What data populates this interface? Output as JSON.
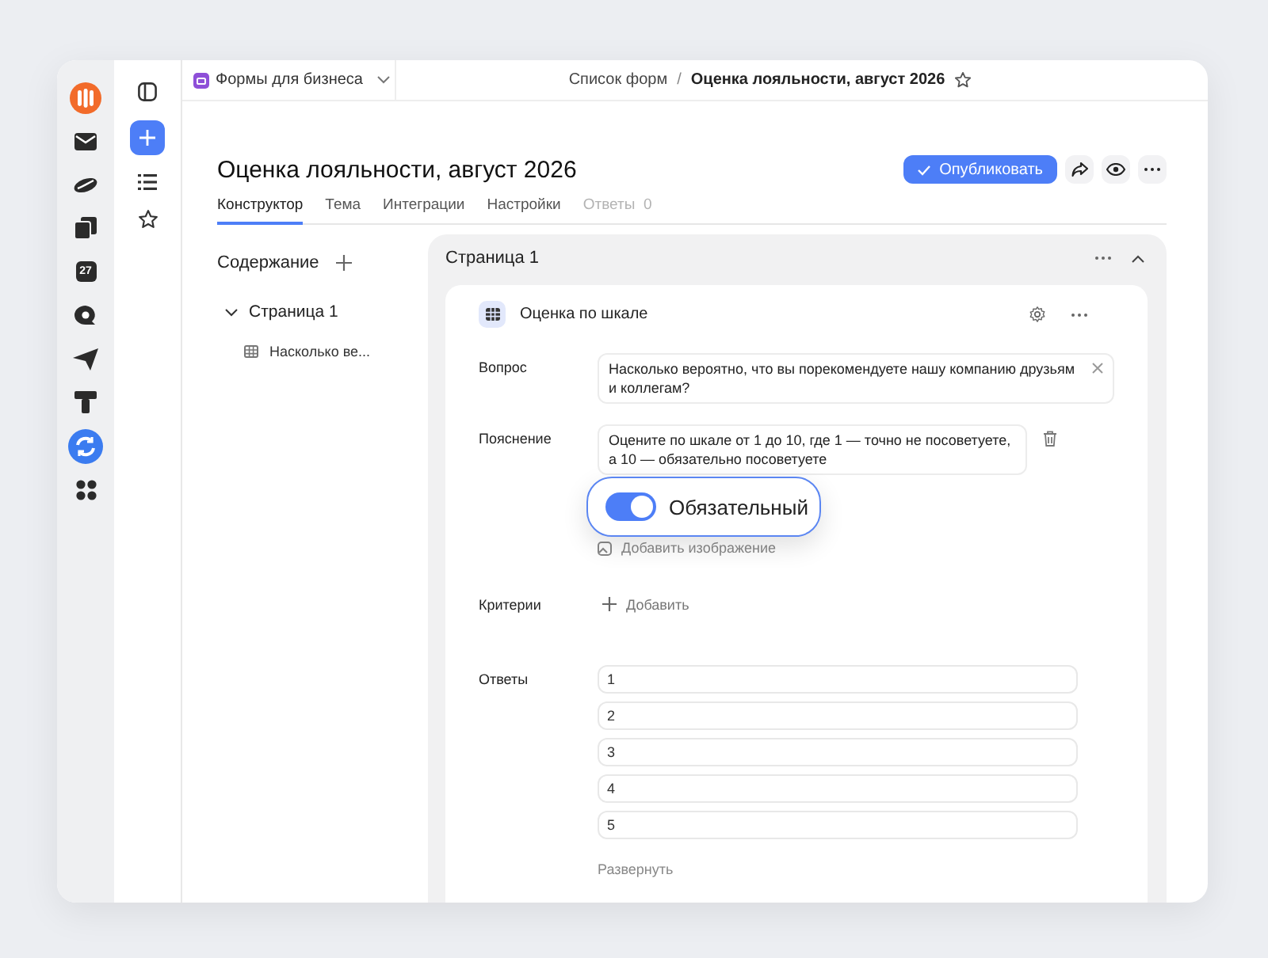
{
  "rail": {
    "items": [
      {
        "kind": "logo"
      },
      {
        "kind": "mail"
      },
      {
        "kind": "cloud"
      },
      {
        "kind": "docs"
      },
      {
        "kind": "calendar",
        "text": "27"
      },
      {
        "kind": "chat"
      },
      {
        "kind": "send"
      },
      {
        "kind": "tracker"
      },
      {
        "kind": "sync"
      },
      {
        "kind": "apps"
      }
    ]
  },
  "subrail": {
    "items": [
      {
        "kind": "panel"
      },
      {
        "kind": "create"
      },
      {
        "kind": "list"
      },
      {
        "kind": "star"
      }
    ]
  },
  "topbar": {
    "workspace": "Формы для бизнеса",
    "breadcrumb": [
      "Список форм",
      "Оценка лояльности, август 2026"
    ],
    "breadcrumb_separator": "/"
  },
  "title": "Оценка лояльности, август 2026",
  "publish_button": "Опубликовать",
  "tabs": [
    {
      "label": "Конструктор",
      "selected": true,
      "disabled": false
    },
    {
      "label": "Тема",
      "selected": false,
      "disabled": false
    },
    {
      "label": "Интеграции",
      "selected": false,
      "disabled": false
    },
    {
      "label": "Настройки",
      "selected": false,
      "disabled": false
    },
    {
      "label": "Ответы",
      "count": "0",
      "selected": false,
      "disabled": true
    }
  ],
  "outline": {
    "heading": "Содержание",
    "pages": [
      {
        "title": "Страница 1",
        "expanded": true,
        "children": [
          {
            "label": "Насколько ве..."
          }
        ]
      }
    ]
  },
  "page": {
    "title": "Страница 1",
    "question": {
      "type": "Оценка по шкале",
      "question_label": "Вопрос",
      "question_value": "Насколько вероятно, что вы порекомендуете нашу компанию друзьям и коллегам?",
      "explanation_label": "Пояснение",
      "explanation_value": "Оцените по шкале от 1 до 10, где 1 — точно не посоветуете, а 10 — обязательно посоветуете",
      "required": {
        "label": "Обязательный",
        "on": true
      },
      "add_image": "Добавить изображение",
      "criteria_label": "Критерии",
      "add_criterion": "Добавить",
      "answers_label": "Ответы",
      "answers": [
        "1",
        "2",
        "3",
        "4",
        "5"
      ],
      "expand": "Развернуть"
    }
  }
}
